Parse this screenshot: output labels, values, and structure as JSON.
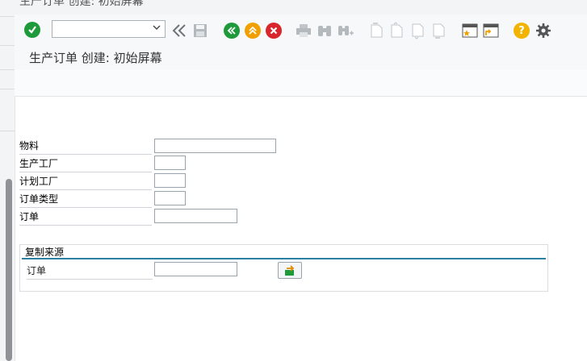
{
  "window": {
    "title_partial": "生产订单 创建: 初始屏幕"
  },
  "toolbar": {
    "command_field": {
      "value": "",
      "placeholder": ""
    },
    "icons": [
      "enter-icon",
      "command-field",
      "back-double-icon",
      "save-icon",
      "back-icon",
      "exit-icon",
      "cancel-icon",
      "print-icon",
      "find-icon",
      "find-next-icon",
      "first-page-icon",
      "previous-page-icon",
      "next-page-icon",
      "last-page-icon",
      "new-session-icon",
      "shortcut-icon",
      "help-icon",
      "settings-icon"
    ]
  },
  "header": {
    "title": "生产订单 创建: 初始屏幕"
  },
  "form": {
    "material": {
      "label": "物料",
      "value": ""
    },
    "production_plant": {
      "label": "生产工厂",
      "value": ""
    },
    "planning_plant": {
      "label": "计划工厂",
      "value": ""
    },
    "order_type": {
      "label": "订单类型",
      "value": ""
    },
    "order": {
      "label": "订单",
      "value": ""
    }
  },
  "copy_from": {
    "title": "复制来源",
    "order": {
      "label": "订单",
      "value": ""
    }
  },
  "colors": {
    "enter_green": "#1e9a3a",
    "nav_orange": "#f0a000",
    "cancel_red": "#d9262c",
    "help_yellow": "#f2b400",
    "group_line": "#2b7fa0"
  }
}
